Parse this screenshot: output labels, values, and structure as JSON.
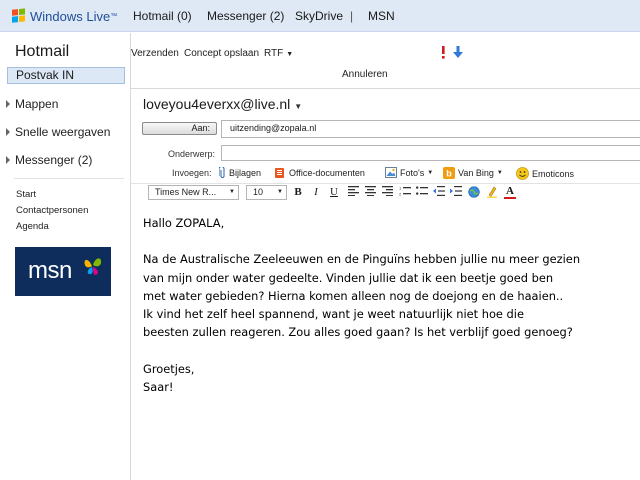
{
  "header": {
    "brand": "Windows Live",
    "brand_tm": "™",
    "nav": {
      "hotmail": "Hotmail (0)",
      "messenger": "Messenger (2)",
      "skydrive": "SkyDrive",
      "separator": "|",
      "msn": "MSN"
    }
  },
  "sidebar": {
    "title": "Hotmail",
    "selected_folder": "Postvak IN",
    "groups": [
      "Mappen",
      "Snelle weergaven",
      "Messenger (2)"
    ],
    "links": [
      "Start",
      "Contactpersonen",
      "Agenda"
    ],
    "logo_text": "msn"
  },
  "toolbar": {
    "send": "Verzenden",
    "save_draft": "Concept opslaan",
    "format": "RTF",
    "cancel": "Annuleren"
  },
  "compose": {
    "from": "loveyou4everxx@live.nl",
    "to_button": "Aan:",
    "to_value": "uitzending@zopala.nl",
    "subject_label": "Onderwerp:",
    "subject_value": "",
    "insert_label": "Invoegen:",
    "insert_items": [
      "Bijlagen",
      "Office-documenten",
      "Foto's",
      "Van Bing",
      "Emoticons"
    ],
    "font_name": "Times New R...",
    "font_size": "10",
    "body": [
      "Hallo ZOPALA,",
      "",
      "Na de Australische Zeeleeuwen en de Pinguïns hebben jullie nu meer gezien",
      "van mijn onder water gedeelte. Vinden jullie dat ik een beetje goed ben",
      "met water gebieden? Hierna komen alleen nog de doejong en de haaien..",
      "Ik vind het zelf heel spannend, want je weet natuurlijk niet hoe die",
      "beesten zullen reageren. Zou alles goed gaan? Is het verblijf goed genoeg?",
      "",
      "Groetjes,",
      "Saar!"
    ]
  },
  "colors": {
    "topbar_bg": "#dfe9f5",
    "selected_bg": "#dde8f6",
    "brand_blue": "#1f4e99",
    "msn_bg": "#0f2d5c"
  }
}
